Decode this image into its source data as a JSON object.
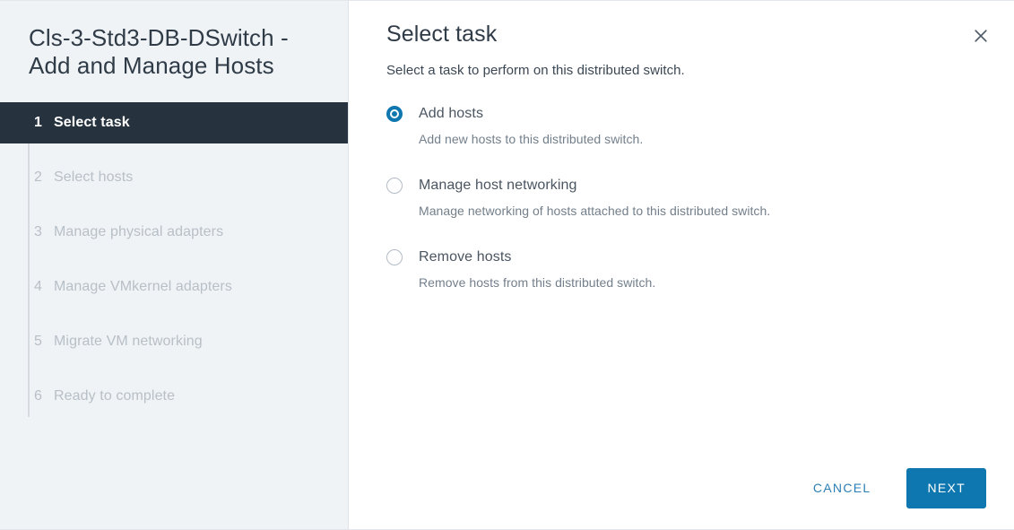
{
  "sidebar": {
    "title": "Cls-3-Std3-DB-DSwitch - Add and Manage Hosts",
    "steps": [
      {
        "num": "1",
        "label": "Select task",
        "active": true
      },
      {
        "num": "2",
        "label": "Select hosts",
        "active": false
      },
      {
        "num": "3",
        "label": "Manage physical adapters",
        "active": false
      },
      {
        "num": "4",
        "label": "Manage VMkernel adapters",
        "active": false
      },
      {
        "num": "5",
        "label": "Migrate VM networking",
        "active": false
      },
      {
        "num": "6",
        "label": "Ready to complete",
        "active": false
      }
    ]
  },
  "panel": {
    "title": "Select task",
    "subtitle": "Select a task to perform on this distributed switch.",
    "close_label": "Close"
  },
  "options": [
    {
      "label": "Add hosts",
      "description": "Add new hosts to this distributed switch.",
      "selected": true
    },
    {
      "label": "Manage host networking",
      "description": "Manage networking of hosts attached to this distributed switch.",
      "selected": false
    },
    {
      "label": "Remove hosts",
      "description": "Remove hosts from this distributed switch.",
      "selected": false
    }
  ],
  "footer": {
    "cancel_label": "CANCEL",
    "next_label": "NEXT"
  },
  "colors": {
    "accent": "#0f77af",
    "link": "#2c7fb5",
    "active_step_bg": "#26333f",
    "sidebar_bg": "#f0f3f6",
    "title_text": "#2f3b47",
    "muted_text": "#b7bfc7"
  }
}
